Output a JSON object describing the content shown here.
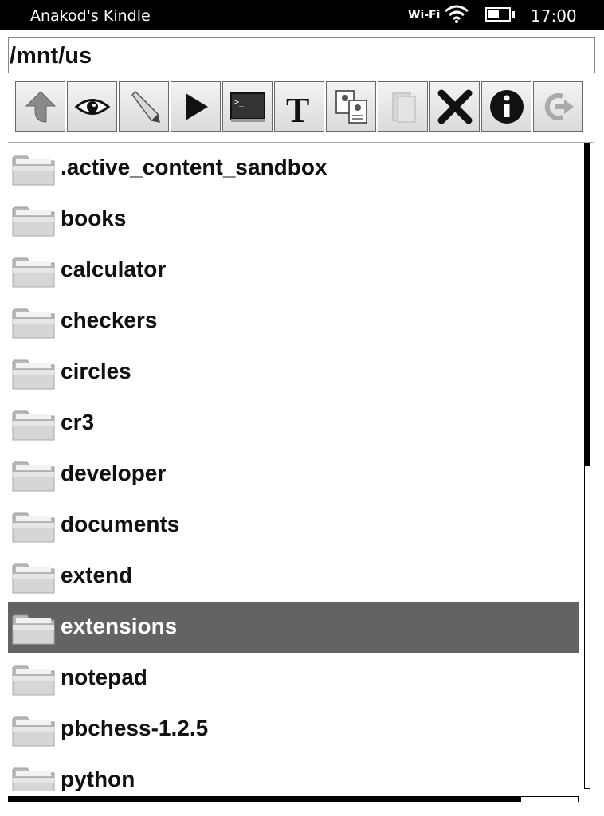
{
  "status_bar": {
    "device_name": "Anakod's Kindle",
    "wifi_label": "Wi-Fi",
    "time": "17:00",
    "battery_level": 0.55
  },
  "path": {
    "value": "/mnt/us"
  },
  "toolbar": {
    "buttons": [
      {
        "name": "up-button",
        "icon": "up-arrow-icon"
      },
      {
        "name": "view-button",
        "icon": "eye-icon"
      },
      {
        "name": "edit-button",
        "icon": "pencil-icon"
      },
      {
        "name": "run-button",
        "icon": "play-icon"
      },
      {
        "name": "terminal-button",
        "icon": "terminal-icon"
      },
      {
        "name": "rename-button",
        "icon": "text-icon"
      },
      {
        "name": "copy-button",
        "icon": "copy-icon"
      },
      {
        "name": "paste-button",
        "icon": "paste-icon",
        "disabled": true
      },
      {
        "name": "delete-button",
        "icon": "delete-icon"
      },
      {
        "name": "info-button",
        "icon": "info-icon"
      },
      {
        "name": "exit-button",
        "icon": "exit-icon",
        "disabled": true
      }
    ]
  },
  "files": {
    "items": [
      {
        "name": ".active_content_sandbox"
      },
      {
        "name": "books"
      },
      {
        "name": "calculator"
      },
      {
        "name": "checkers"
      },
      {
        "name": "circles"
      },
      {
        "name": "cr3"
      },
      {
        "name": "developer"
      },
      {
        "name": "documents"
      },
      {
        "name": "extend"
      },
      {
        "name": "extensions",
        "selected": true
      },
      {
        "name": "notepad"
      },
      {
        "name": "pbchess-1.2.5"
      },
      {
        "name": "python"
      }
    ],
    "vertical_scroll_fraction": 0.5,
    "horizontal_scroll_fraction": 0.9
  }
}
